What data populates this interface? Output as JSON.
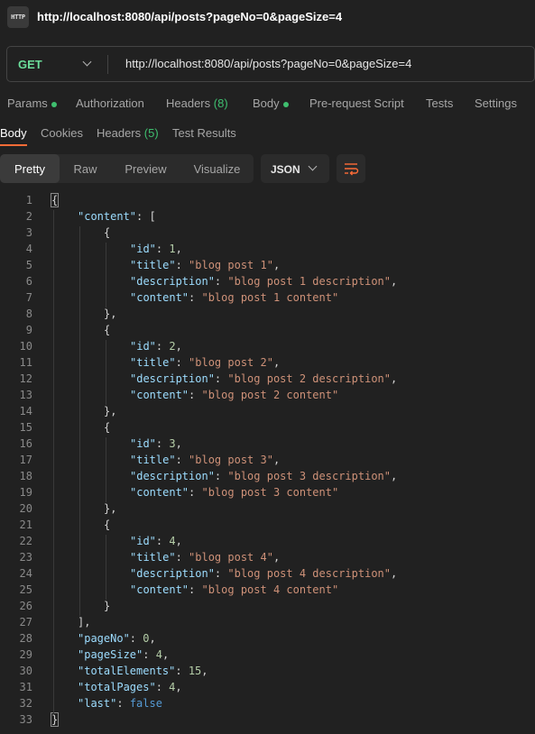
{
  "window": {
    "icon_text": "HTTP",
    "title": "http://localhost:8080/api/posts?pageNo=0&pageSize=4"
  },
  "request": {
    "method": "GET",
    "url": "http://localhost:8080/api/posts?pageNo=0&pageSize=4"
  },
  "request_tabs": [
    {
      "label": "Params",
      "dot": true
    },
    {
      "label": "Authorization",
      "dot": false
    },
    {
      "label": "Headers",
      "count": "(8)",
      "dot": false
    },
    {
      "label": "Body",
      "dot": true
    },
    {
      "label": "Pre-request Script",
      "dot": false
    },
    {
      "label": "Tests",
      "dot": false
    },
    {
      "label": "Settings",
      "dot": false
    }
  ],
  "response_tabs": [
    {
      "label": "Body",
      "active": true
    },
    {
      "label": "Cookies"
    },
    {
      "label": "Headers",
      "count": "(5)"
    },
    {
      "label": "Test Results"
    }
  ],
  "view_modes": [
    "Pretty",
    "Raw",
    "Preview",
    "Visualize"
  ],
  "active_view": "Pretty",
  "format": "JSON",
  "icons": {
    "app": "http-icon",
    "method_dropdown": "chevron-down-icon",
    "format_dropdown": "chevron-down-icon",
    "wrap": "wrap-lines-icon"
  },
  "colors": {
    "accent": "#ff6c37",
    "method_get": "#6bdd9a",
    "status_dot": "#3fbf6f",
    "json_key": "#9cdcfe",
    "json_string": "#ce9178",
    "json_number": "#b5cea8",
    "json_boolean": "#569cd6"
  },
  "code_lines": [
    [
      [
        "p",
        "{"
      ]
    ],
    [
      [
        "k",
        "\"content\""
      ],
      [
        "p",
        ": ["
      ]
    ],
    [
      [
        "p",
        "{"
      ]
    ],
    [
      [
        "k",
        "\"id\""
      ],
      [
        "p",
        ": "
      ],
      [
        "n",
        "1"
      ],
      [
        "p",
        ","
      ]
    ],
    [
      [
        "k",
        "\"title\""
      ],
      [
        "p",
        ": "
      ],
      [
        "s",
        "\"blog post 1\""
      ],
      [
        "p",
        ","
      ]
    ],
    [
      [
        "k",
        "\"description\""
      ],
      [
        "p",
        ": "
      ],
      [
        "s",
        "\"blog post 1 description\""
      ],
      [
        "p",
        ","
      ]
    ],
    [
      [
        "k",
        "\"content\""
      ],
      [
        "p",
        ": "
      ],
      [
        "s",
        "\"blog post 1 content\""
      ]
    ],
    [
      [
        "p",
        "},"
      ]
    ],
    [
      [
        "p",
        "{"
      ]
    ],
    [
      [
        "k",
        "\"id\""
      ],
      [
        "p",
        ": "
      ],
      [
        "n",
        "2"
      ],
      [
        "p",
        ","
      ]
    ],
    [
      [
        "k",
        "\"title\""
      ],
      [
        "p",
        ": "
      ],
      [
        "s",
        "\"blog post 2\""
      ],
      [
        "p",
        ","
      ]
    ],
    [
      [
        "k",
        "\"description\""
      ],
      [
        "p",
        ": "
      ],
      [
        "s",
        "\"blog post 2 description\""
      ],
      [
        "p",
        ","
      ]
    ],
    [
      [
        "k",
        "\"content\""
      ],
      [
        "p",
        ": "
      ],
      [
        "s",
        "\"blog post 2 content\""
      ]
    ],
    [
      [
        "p",
        "},"
      ]
    ],
    [
      [
        "p",
        "{"
      ]
    ],
    [
      [
        "k",
        "\"id\""
      ],
      [
        "p",
        ": "
      ],
      [
        "n",
        "3"
      ],
      [
        "p",
        ","
      ]
    ],
    [
      [
        "k",
        "\"title\""
      ],
      [
        "p",
        ": "
      ],
      [
        "s",
        "\"blog post 3\""
      ],
      [
        "p",
        ","
      ]
    ],
    [
      [
        "k",
        "\"description\""
      ],
      [
        "p",
        ": "
      ],
      [
        "s",
        "\"blog post 3 description\""
      ],
      [
        "p",
        ","
      ]
    ],
    [
      [
        "k",
        "\"content\""
      ],
      [
        "p",
        ": "
      ],
      [
        "s",
        "\"blog post 3 content\""
      ]
    ],
    [
      [
        "p",
        "},"
      ]
    ],
    [
      [
        "p",
        "{"
      ]
    ],
    [
      [
        "k",
        "\"id\""
      ],
      [
        "p",
        ": "
      ],
      [
        "n",
        "4"
      ],
      [
        "p",
        ","
      ]
    ],
    [
      [
        "k",
        "\"title\""
      ],
      [
        "p",
        ": "
      ],
      [
        "s",
        "\"blog post 4\""
      ],
      [
        "p",
        ","
      ]
    ],
    [
      [
        "k",
        "\"description\""
      ],
      [
        "p",
        ": "
      ],
      [
        "s",
        "\"blog post 4 description\""
      ],
      [
        "p",
        ","
      ]
    ],
    [
      [
        "k",
        "\"content\""
      ],
      [
        "p",
        ": "
      ],
      [
        "s",
        "\"blog post 4 content\""
      ]
    ],
    [
      [
        "p",
        "}"
      ]
    ],
    [
      [
        "p",
        "],"
      ]
    ],
    [
      [
        "k",
        "\"pageNo\""
      ],
      [
        "p",
        ": "
      ],
      [
        "n",
        "0"
      ],
      [
        "p",
        ","
      ]
    ],
    [
      [
        "k",
        "\"pageSize\""
      ],
      [
        "p",
        ": "
      ],
      [
        "n",
        "4"
      ],
      [
        "p",
        ","
      ]
    ],
    [
      [
        "k",
        "\"totalElements\""
      ],
      [
        "p",
        ": "
      ],
      [
        "n",
        "15"
      ],
      [
        "p",
        ","
      ]
    ],
    [
      [
        "k",
        "\"totalPages\""
      ],
      [
        "p",
        ": "
      ],
      [
        "n",
        "4"
      ],
      [
        "p",
        ","
      ]
    ],
    [
      [
        "k",
        "\"last\""
      ],
      [
        "p",
        ": "
      ],
      [
        "b",
        "false"
      ]
    ],
    [
      [
        "p",
        "}"
      ]
    ]
  ]
}
